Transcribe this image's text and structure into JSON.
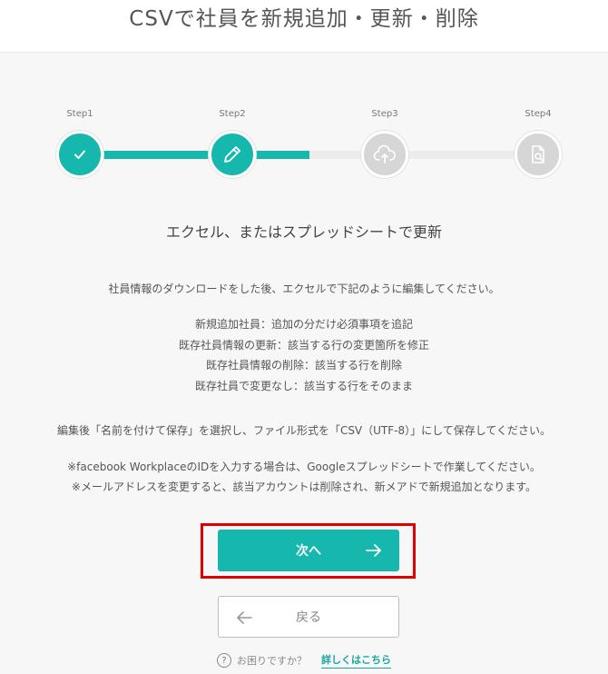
{
  "header": {
    "title": "CSVで社員を新規追加・更新・削除"
  },
  "steps": [
    {
      "label": "Step1",
      "icon": "check-icon",
      "state": "done"
    },
    {
      "label": "Step2",
      "icon": "pencil-icon",
      "state": "active"
    },
    {
      "label": "Step3",
      "icon": "cloud-upload-icon",
      "state": "inactive"
    },
    {
      "label": "Step4",
      "icon": "file-search-icon",
      "state": "inactive"
    }
  ],
  "progress_fraction": 0.5,
  "main": {
    "subtitle": "エクセル、またはスプレッドシートで更新",
    "intro": "社員情報のダウンロードをした後、エクセルで下記のように編集してください。",
    "rules": [
      "新規追加社員：追加の分だけ必須事項を追記",
      "既存社員情報の更新：該当する行の変更箇所を修正",
      "既存社員情報の削除：該当する行を削除",
      "既存社員で変更なし：該当する行をそのまま"
    ],
    "save_note": "編集後「名前を付けて保存」を選択し、ファイル形式を「CSV（UTF-8）」にして保存してください。",
    "notes": [
      "※facebook WorkplaceのIDを入力する場合は、Googleスプレッドシートで作業してください。",
      "※メールアドレスを変更すると、該当アカウントは削除され、新メアドで新規追加となります。"
    ]
  },
  "buttons": {
    "next": "次へ",
    "back": "戻る"
  },
  "help": {
    "question": "お困りですか？",
    "link": "詳しくはこちら",
    "icon_glyph": "?"
  },
  "colors": {
    "accent": "#16b8ad",
    "inactive": "#d6d6d6",
    "highlight": "#e00000"
  }
}
